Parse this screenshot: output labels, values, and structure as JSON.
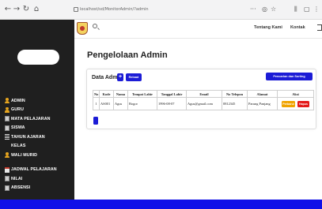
{
  "browser": {
    "url": "localhost/sd/MonitorAdmin/?admin",
    "controls": {
      "back": "←",
      "forward": "→",
      "reload": "↻",
      "home": "⌂"
    },
    "right_icons": {
      "menu": "···",
      "shield": "◎",
      "star": "☆",
      "library": "⫼",
      "reader": "▢",
      "more": "⋮"
    }
  },
  "header": {
    "nav": [
      "Tentang Kami",
      "Kontak"
    ]
  },
  "sidebar": {
    "items": [
      {
        "label": "ADMIN",
        "icon": "person-icon"
      },
      {
        "label": "GURU",
        "icon": "person-icon"
      },
      {
        "label": "MATA PELAJARAN",
        "icon": "book-icon"
      },
      {
        "label": "SISWA",
        "icon": "book-icon"
      },
      {
        "label": "TAHUN AJARAN",
        "icon": "bars-icon"
      },
      {
        "label": "KELAS",
        "icon": "blank"
      },
      {
        "label": "WALI MURID",
        "icon": "person-icon"
      },
      {
        "label": "JADWAL PELAJARAN",
        "icon": "calendar-icon"
      },
      {
        "label": "NILAI",
        "icon": "book-icon"
      },
      {
        "label": "ABSENSI",
        "icon": "book-icon"
      }
    ]
  },
  "main": {
    "page_title": "Pengelolaan Admin",
    "card": {
      "title": "Data Admin",
      "add_label": "+",
      "reload_label": "Reload",
      "search_label": "Pencarian dan Sorting",
      "columns": [
        "No",
        "Kode",
        "Nama",
        "Tempat Lahir",
        "Tanggal Lahir",
        "Email",
        "No Telepon",
        "Alamat",
        "Aksi"
      ],
      "rows": [
        {
          "no": "1",
          "kode": "AS001",
          "nama": "Agus",
          "tempat_lahir": "Bogor",
          "tanggal_lahir": "1996-08-07",
          "email": "Agus@gmail.com",
          "telepon": "0812345",
          "alamat": "Parung Panjang",
          "edit_label": "Perbarui",
          "delete_label": "Hapus"
        }
      ]
    }
  },
  "colors": {
    "sidebar_bg": "#1f1f1f",
    "primary": "#1c1cd6",
    "warning": "#f0a400",
    "danger": "#e31919",
    "footer": "#1010e8"
  }
}
